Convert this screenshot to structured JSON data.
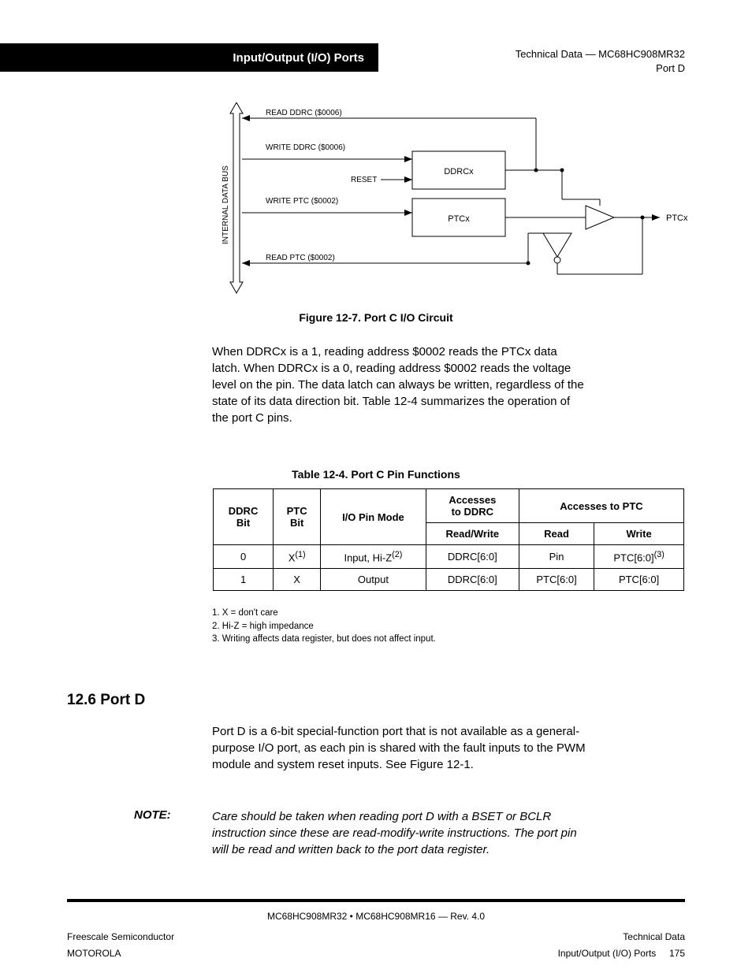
{
  "header": {
    "blackbar": "Input/Output (I/O) Ports",
    "runhead1": "Technical Data — MC68HC908MR32",
    "runhead2": "Port D"
  },
  "figure": {
    "busLabel": "INTERNAL DATA BUS",
    "readDdrc": "READ DDRC ($0006)",
    "writeDdrc": "WRITE DDRC ($0006)",
    "reset": "RESET",
    "ddrcx": "DDRCx",
    "writePtc": "WRITE PTC ($0002)",
    "ptcxBox": "PTCx",
    "readPtc": "READ PTC ($0002)",
    "ptcxPin": "PTCx",
    "caption": "Figure 12-7. Port C I/O Circuit"
  },
  "whenPara": {
    "l1": "When DDRCx is a 1, reading address $0002 reads the PTCx data",
    "l2": "latch. When DDRCx is a 0, reading address $0002 reads the voltage",
    "l3": "level on the pin. The data latch can always be written, regardless of the",
    "l4": "state of its data direction bit. Table 12-4 summarizes the operation of",
    "l5": "the port C pins."
  },
  "table": {
    "caption": "Table 12-4. Port C Pin Functions",
    "headers": {
      "ddrc": "DDRC\nBit",
      "ptc": "PTC\nBit",
      "io": "I/O Pin Mode",
      "access": "Accesses\nto DDRC",
      "accessPtc": "Accesses to PTC",
      "rw": "Read/Write",
      "read": "Read",
      "write": "Write"
    },
    "rows": [
      {
        "ddrc": "0",
        "ptc_html": "X<sup>(1)</sup>",
        "io_html": "Input, Hi-Z<sup>(2)</sup>",
        "access": "DDRC[6:0]",
        "read_html": "Pin",
        "write_html": "PTC[6:0]<sup>(3)</sup>"
      },
      {
        "ddrc": "1",
        "ptc_html": "X",
        "io_html": "Output",
        "access": "DDRC[6:0]",
        "read_html": "PTC[6:0]",
        "write_html": "PTC[6:0]"
      }
    ],
    "notes": {
      "n1": "1. X = don't care",
      "n2": "2. Hi-Z = high impedance",
      "n3": "3. Writing affects data register, but does not affect input."
    }
  },
  "section": {
    "heading": "12.6  Port D",
    "body1": "Port D is a 6-bit special-function port that is not available as a general-",
    "body2": "purpose I/O port, as each pin is shared with the fault inputs to the PWM",
    "body3": "module and system reset inputs. See Figure 12-1.",
    "noteLabel": "NOTE:",
    "note1": "Care should be taken when reading port D with a BSET or BCLR",
    "note2": "instruction since these are read-modify-write instructions. The port pin",
    "note3": "will be read and written back to the port data register."
  },
  "footer": {
    "doc": "MC68HC908MR32 • MC68HC908MR16 — Rev. 4.0",
    "company": "Freescale Semiconductor",
    "rev": "Technical Data",
    "section": "MOTOROLA",
    "pagelabel": "Input/Output (I/O) Ports",
    "pagenum": "175"
  },
  "chart_data": {
    "type": "diagram",
    "description": "Port C I/O circuit block diagram",
    "bus": "INTERNAL DATA BUS (bidirectional vertical)",
    "signals": [
      {
        "name": "READ DDRC ($0006)",
        "dir": "into bus"
      },
      {
        "name": "WRITE DDRC ($0006)",
        "dir": "from bus",
        "target": "DDRCx",
        "reset_input": true
      },
      {
        "name": "WRITE PTC ($0002)",
        "dir": "from bus",
        "target": "PTCx latch"
      },
      {
        "name": "READ PTC ($0002)",
        "dir": "into bus"
      }
    ],
    "blocks": [
      "DDRCx",
      "PTCx"
    ],
    "output_buffer": {
      "enable_from": "DDRCx",
      "data_from": "PTCx latch",
      "to_pin": "PTCx"
    },
    "input_buffer": {
      "from_pin": "PTCx",
      "enable_inverted_from": "DDRCx",
      "to": "READ PTC path"
    }
  }
}
